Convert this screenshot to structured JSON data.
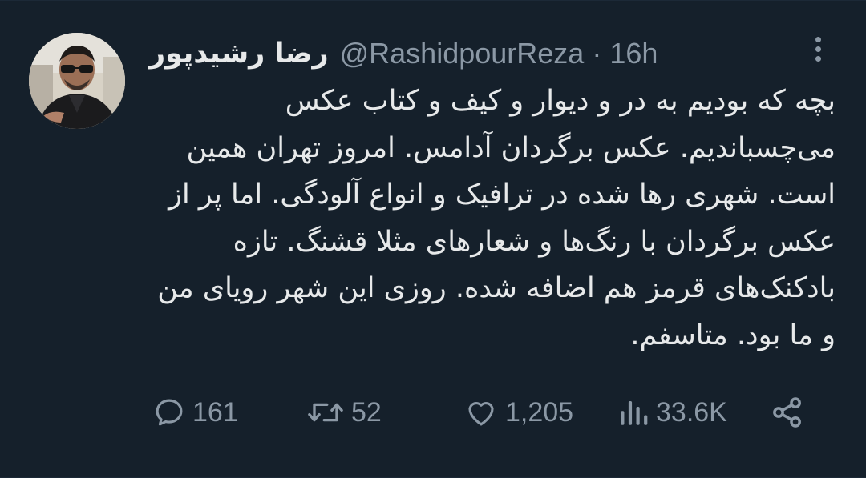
{
  "author": {
    "display_name": "رضا رشیدپور",
    "handle": "@RashidpourReza",
    "separator": "·",
    "time_ago": "16h"
  },
  "tweet": {
    "text": "بچه که بودیم به در و دیوار و کیف و کتاب عکس می‌چسباندیم. عکس برگردان آدامس. امروز تهران همین است. شهری رها شده در ترافیک و انواع آلودگی. اما پر از عکس برگردان با رنگ‌ها و شعارهای مثلا قشنگ. تازه بادکنک‌های قرمز هم اضافه شده. روزی این شهر رویای من و ما بود. متاسفم."
  },
  "actions": {
    "replies": "161",
    "retweets": "52",
    "likes": "1,205",
    "views": "33.6K"
  },
  "icons": {
    "more": "more-vertical-icon",
    "reply": "reply-icon",
    "retweet": "retweet-icon",
    "like": "heart-icon",
    "views": "views-bar-chart-icon",
    "share": "share-icon"
  },
  "colors": {
    "background": "#15202b",
    "primary_text": "#e7e9ea",
    "secondary_text": "#8b98a5"
  }
}
